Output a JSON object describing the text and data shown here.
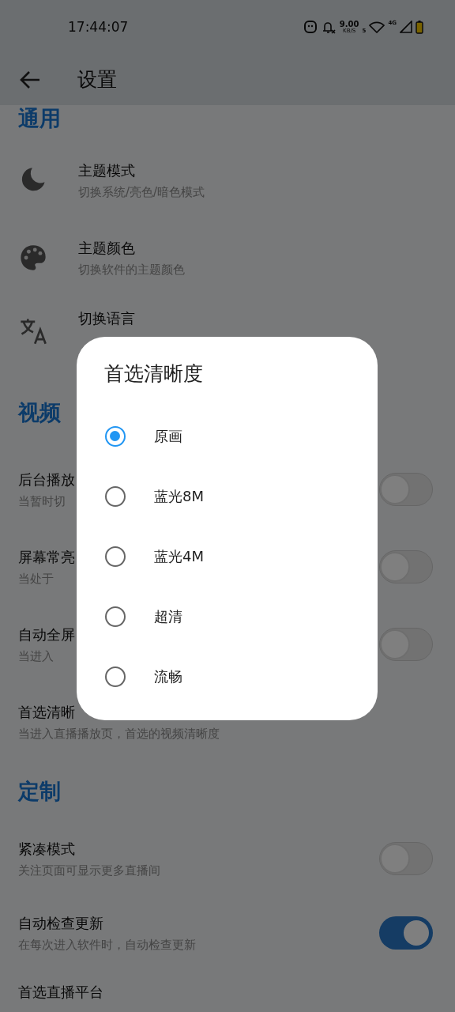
{
  "status_bar": {
    "time": "17:44:07",
    "net_speed": "9.00",
    "net_unit": "KB/S",
    "wifi_badge": "5",
    "cell_badge": "4G"
  },
  "app_bar": {
    "title": "设置"
  },
  "sections": [
    {
      "title": "通用",
      "items": [
        {
          "kind": "icon",
          "title": "主题模式",
          "subtitle": "切换系统/亮色/暗色模式"
        },
        {
          "kind": "icon",
          "title": "主题颜色",
          "subtitle": "切换软件的主题颜色"
        },
        {
          "kind": "icon",
          "title": "切换语言"
        }
      ]
    },
    {
      "title": "视频",
      "items": [
        {
          "kind": "toggle",
          "title": "后台播放",
          "subtitle": "当暂时切",
          "on": false
        },
        {
          "kind": "toggle",
          "title": "屏幕常亮",
          "subtitle": "当处于",
          "on": false
        },
        {
          "kind": "toggle",
          "title": "自动全屏",
          "subtitle": "当进入",
          "on": false
        },
        {
          "kind": "plain",
          "title": "首选清晰",
          "subtitle": "当进入直播播放页，首选的视频清晰度"
        }
      ]
    },
    {
      "title": "定制",
      "items": [
        {
          "kind": "toggle",
          "title": "紧凑模式",
          "subtitle": "关注页面可显示更多直播间",
          "on": false
        },
        {
          "kind": "toggle",
          "title": "自动检查更新",
          "subtitle": "在每次进入软件时，自动检查更新",
          "on": true
        },
        {
          "kind": "plain",
          "title": "首选直播平台"
        }
      ]
    }
  ],
  "dialog": {
    "title": "首选清晰度",
    "options": [
      {
        "label": "原画",
        "selected": true
      },
      {
        "label": "蓝光8M",
        "selected": false
      },
      {
        "label": "蓝光4M",
        "selected": false
      },
      {
        "label": "超清",
        "selected": false
      },
      {
        "label": "流畅",
        "selected": false
      }
    ]
  }
}
